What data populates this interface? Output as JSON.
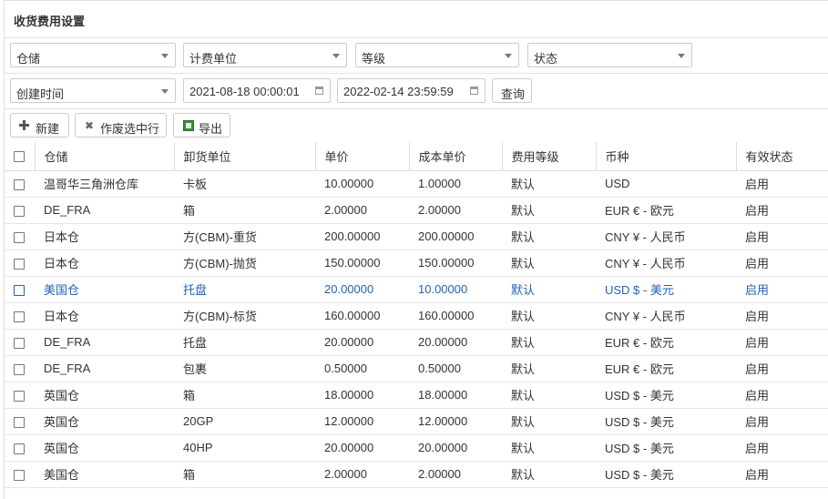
{
  "title": "收货费用设置",
  "filters": {
    "warehouse": "仓储",
    "billing_unit": "计费单位",
    "level": "等级",
    "status": "状态",
    "created_time": "创建时间",
    "date_from": "2021-08-18 00:00:01",
    "date_to": "2022-02-14 23:59:59",
    "query_label": "查询"
  },
  "toolbar": {
    "new_label": "新建",
    "void_label": "作废选中行",
    "export_label": "导出"
  },
  "table": {
    "headers": [
      "仓储",
      "卸货单位",
      "单价",
      "成本单价",
      "费用等级",
      "币种",
      "有效状态"
    ],
    "rows": [
      [
        "温哥华三角洲仓库",
        "卡板",
        "10.00000",
        "1.00000",
        "默认",
        "USD",
        "启用"
      ],
      [
        "DE_FRA",
        "箱",
        "2.00000",
        "2.00000",
        "默认",
        "EUR € - 欧元",
        "启用"
      ],
      [
        "日本仓",
        "方(CBM)-重货",
        "200.00000",
        "200.00000",
        "默认",
        "CNY ¥ - 人民币",
        "启用"
      ],
      [
        "日本仓",
        "方(CBM)-抛货",
        "150.00000",
        "150.00000",
        "默认",
        "CNY ¥ - 人民币",
        "启用"
      ],
      [
        "美国仓",
        "托盘",
        "20.00000",
        "10.00000",
        "默认",
        "USD $ - 美元",
        "启用"
      ],
      [
        "日本仓",
        "方(CBM)-标货",
        "160.00000",
        "160.00000",
        "默认",
        "CNY ¥ - 人民币",
        "启用"
      ],
      [
        "DE_FRA",
        "托盘",
        "20.00000",
        "20.00000",
        "默认",
        "EUR € - 欧元",
        "启用"
      ],
      [
        "DE_FRA",
        "包裹",
        "0.50000",
        "0.50000",
        "默认",
        "EUR € - 欧元",
        "启用"
      ],
      [
        "英国仓",
        "箱",
        "18.00000",
        "18.00000",
        "默认",
        "USD $ - 美元",
        "启用"
      ],
      [
        "英国仓",
        "20GP",
        "12.00000",
        "12.00000",
        "默认",
        "USD $ - 美元",
        "启用"
      ],
      [
        "英国仓",
        "40HP",
        "20.00000",
        "20.00000",
        "默认",
        "USD $ - 美元",
        "启用"
      ],
      [
        "美国仓",
        "箱",
        "2.00000",
        "2.00000",
        "默认",
        "USD $ - 美元",
        "启用"
      ]
    ],
    "highlighted_row": 4,
    "highlight_color": "#1f63b5"
  }
}
